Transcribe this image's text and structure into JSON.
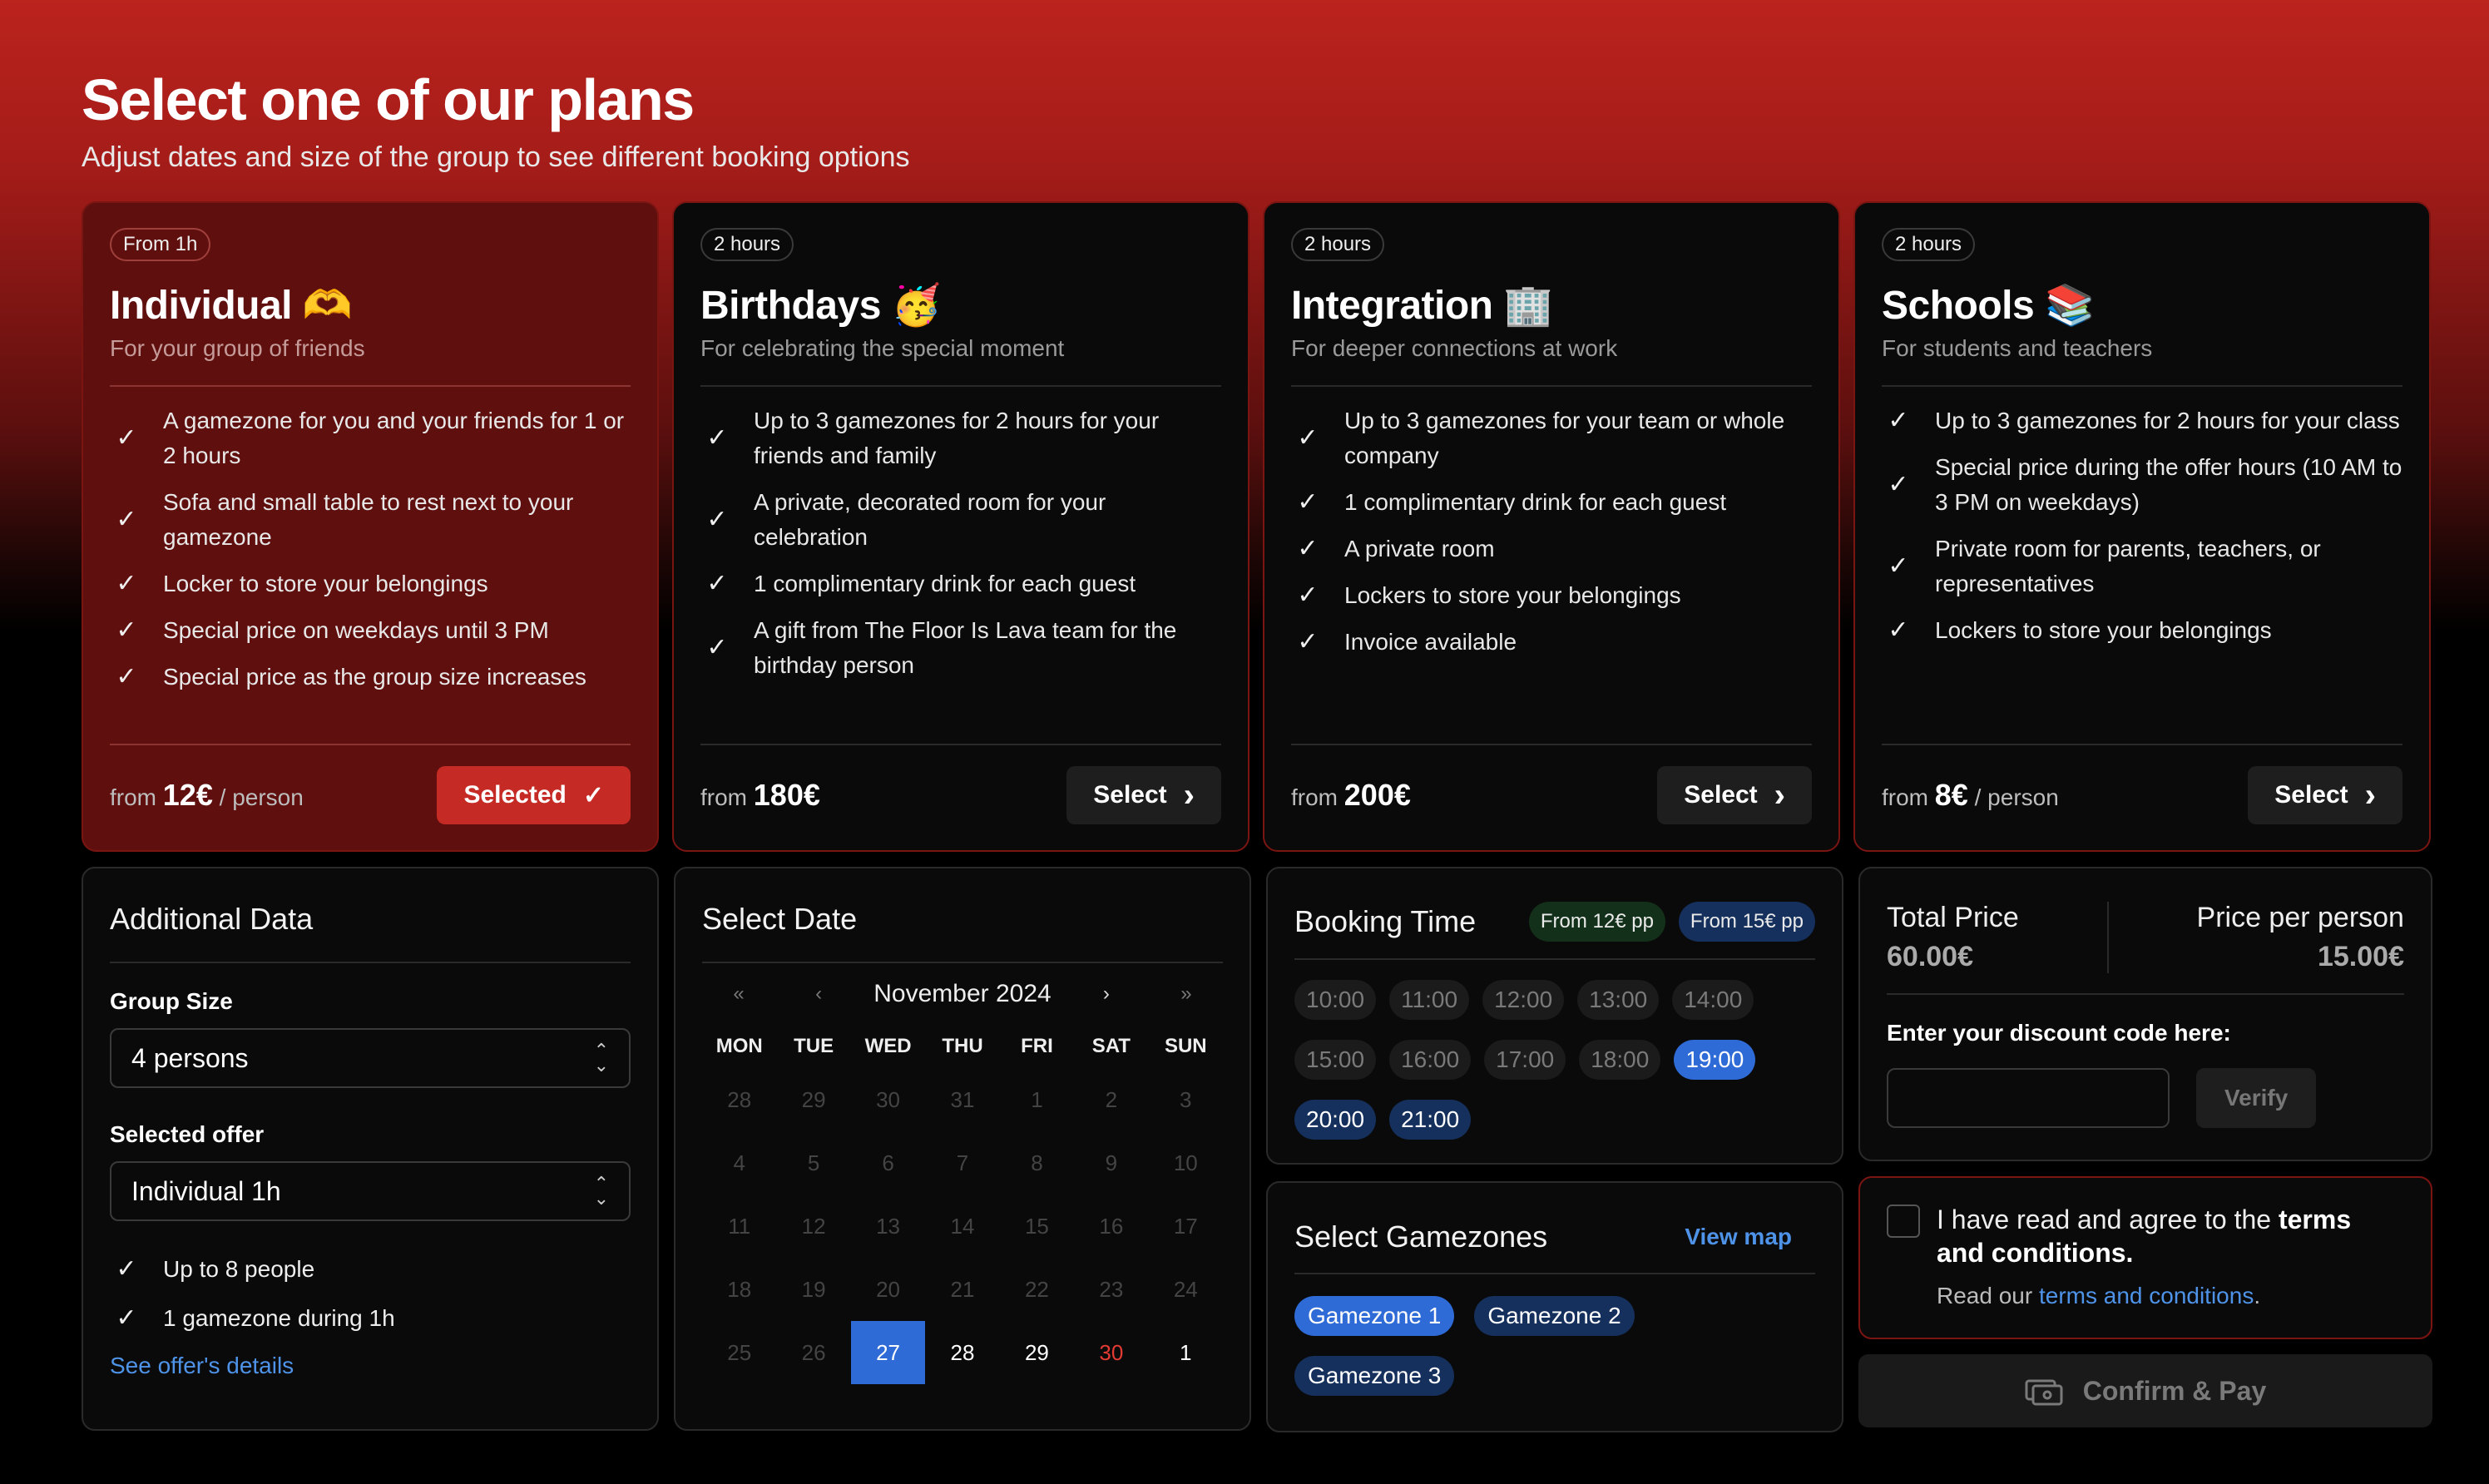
{
  "header": {
    "title": "Select one of our plans",
    "subtitle": "Adjust dates and size of the group to see different booking options"
  },
  "plans": [
    {
      "badge": "From 1h",
      "name": "Individual 🫶",
      "desc": "For your group of friends",
      "features": [
        "A gamezone for you and your friends for 1 or 2 hours",
        "Sofa and small table to rest next to your gamezone",
        "Locker to store your belongings",
        "Special price on weekdays until 3 PM",
        "Special price as the group size increases"
      ],
      "price_prefix": "from",
      "price": "12€",
      "price_suffix": "/ person",
      "button": "Selected"
    },
    {
      "badge": "2 hours",
      "name": "Birthdays 🥳",
      "desc": "For celebrating the special moment",
      "features": [
        "Up to 3 gamezones for 2 hours for your friends and family",
        "A private, decorated room for your celebration",
        "1 complimentary drink for each guest",
        "A gift from The Floor Is Lava team for the birthday person"
      ],
      "price_prefix": "from",
      "price": "180€",
      "price_suffix": "",
      "button": "Select"
    },
    {
      "badge": "2 hours",
      "name": "Integration 🏢",
      "desc": "For deeper connections at work",
      "features": [
        "Up to 3 gamezones for your team or whole company",
        "1 complimentary drink for each guest",
        "A private room",
        "Lockers to store your belongings",
        "Invoice available"
      ],
      "price_prefix": "from",
      "price": "200€",
      "price_suffix": "",
      "button": "Select"
    },
    {
      "badge": "2 hours",
      "name": "Schools 📚",
      "desc": "For students and teachers",
      "features": [
        "Up to 3 gamezones for 2 hours for your class",
        "Special price during the offer hours (10 AM to 3 PM on weekdays)",
        "Private room for parents, teachers, or representatives",
        "Lockers to store your belongings"
      ],
      "price_prefix": "from",
      "price": "8€",
      "price_suffix": "/ person",
      "button": "Select"
    }
  ],
  "additional": {
    "title": "Additional Data",
    "group_label": "Group Size",
    "group_value": "4 persons",
    "offer_label": "Selected offer",
    "offer_value": "Individual 1h",
    "features": [
      "Up to 8 people",
      "1 gamezone during 1h"
    ],
    "details_link": "See offer's details"
  },
  "calendar": {
    "title": "Select Date",
    "month": "November 2024",
    "nav": [
      "«",
      "‹",
      "›",
      "»"
    ],
    "dow": [
      "MON",
      "TUE",
      "WED",
      "THU",
      "FRI",
      "SAT",
      "SUN"
    ],
    "days": [
      [
        "28",
        "29",
        "30",
        "31",
        "1",
        "2",
        "3"
      ],
      [
        "4",
        "5",
        "6",
        "7",
        "8",
        "9",
        "10"
      ],
      [
        "11",
        "12",
        "13",
        "14",
        "15",
        "16",
        "17"
      ],
      [
        "18",
        "19",
        "20",
        "21",
        "22",
        "23",
        "24"
      ],
      [
        "25",
        "26",
        "27",
        "28",
        "29",
        "30",
        "1"
      ]
    ],
    "selected": "27"
  },
  "booking": {
    "title": "Booking Time",
    "pill_a": "From 12€ pp",
    "pill_b": "From 15€ pp",
    "times": [
      "10:00",
      "11:00",
      "12:00",
      "13:00",
      "14:00",
      "15:00",
      "16:00",
      "17:00",
      "18:00",
      "19:00",
      "20:00",
      "21:00"
    ],
    "selected": "19:00"
  },
  "gamezones": {
    "title": "Select Gamezones",
    "view_map": "View map",
    "zones": [
      "Gamezone 1",
      "Gamezone 2",
      "Gamezone 3"
    ],
    "selected": "Gamezone 1"
  },
  "total": {
    "total_label": "Total Price",
    "total_value": "60.00€",
    "pp_label": "Price per person",
    "pp_value": "15.00€",
    "discount_label": "Enter your discount code here:",
    "discount_value": "",
    "verify": "Verify"
  },
  "terms": {
    "text": "I have read and agree to the",
    "bold": "terms and conditions",
    "read_prefix": "Read our",
    "read_link": "terms and conditions"
  },
  "confirm": "Confirm & Pay",
  "colors": {
    "accent": "#c52a25",
    "blue": "#2f6bd6",
    "link": "#4e93e8"
  }
}
